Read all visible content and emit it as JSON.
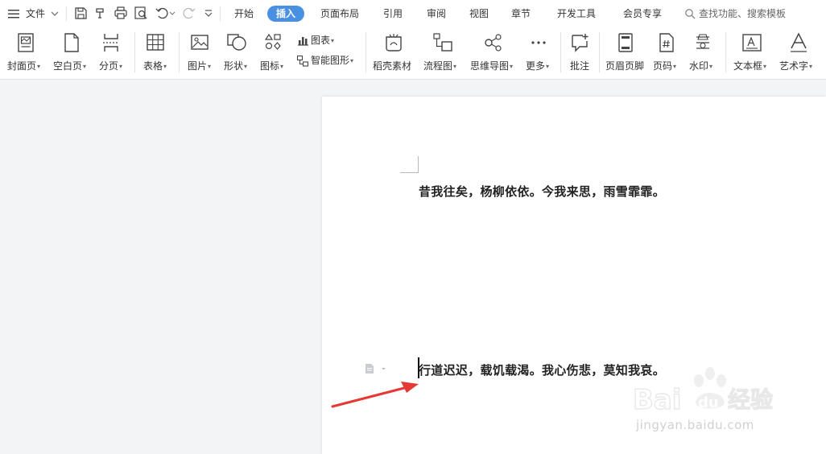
{
  "menubar": {
    "file_label": "文件",
    "tabs": [
      "开始",
      "插入",
      "页面布局",
      "引用",
      "审阅",
      "视图",
      "章节",
      "开发工具",
      "会员专享"
    ],
    "active_tab": "插入",
    "search_text": "查找功能、搜索模板"
  },
  "ribbon": {
    "cover": "封面页",
    "blank": "空白页",
    "pagebreak": "分页",
    "table": "表格",
    "picture": "图片",
    "shape": "形状",
    "icon": "图标",
    "chart": "图表",
    "smartart": "智能图形",
    "material": "稻壳素材",
    "flowchart": "流程图",
    "mindmap": "思维导图",
    "more": "更多",
    "comment": "批注",
    "headerfooter": "页眉页脚",
    "pagenum": "页码",
    "watermark": "水印",
    "textbox": "文本框",
    "wordart": "艺术字"
  },
  "document": {
    "line1": "昔我往矣，杨柳依依。今我来思，雨雪霏霏。",
    "line2": "行道迟迟，载饥载渴。我心伤悲，莫知我哀。"
  },
  "watermark": {
    "brand": "Bai",
    "brand_du": "du",
    "brand_cn": "经验",
    "url": "jingyan.baidu.com"
  },
  "colors": {
    "accent": "#4a90e2",
    "arrow": "#e53935"
  }
}
